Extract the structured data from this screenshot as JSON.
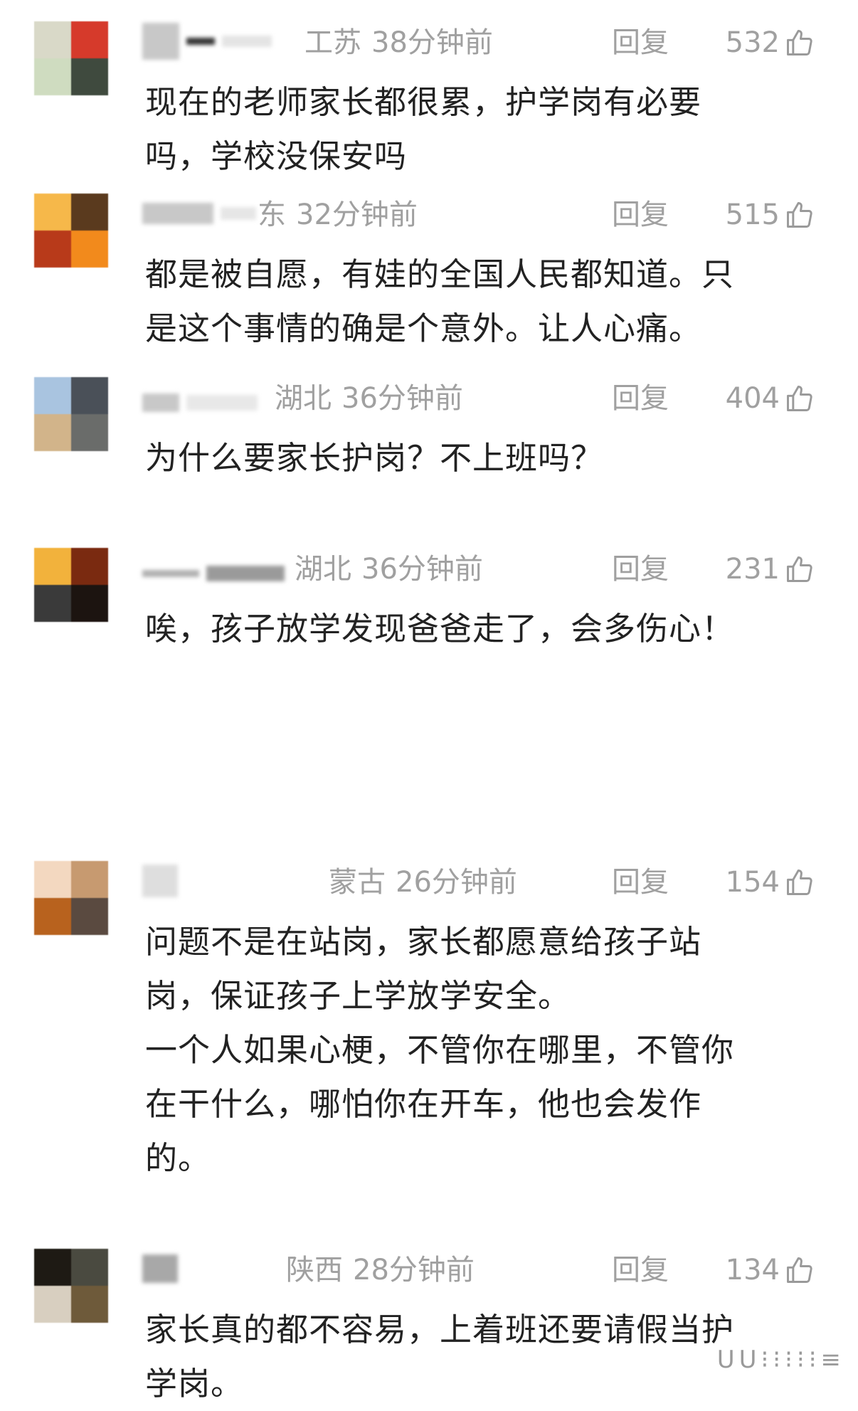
{
  "reply_label": "回复",
  "comments": [
    {
      "location": "工苏",
      "time": "38分钟前",
      "likes": "532",
      "text": "现在的老师家长都很累，护学岗有必要\n吗，学校没保安吗",
      "avatar_colors": [
        "#d9d9c8",
        "#d63a2b",
        "#cfdcc0",
        "#3f4a3e"
      ]
    },
    {
      "location": "东",
      "time": "32分钟前",
      "likes": "515",
      "text": "都是被自愿，有娃的全国人民都知道。只\n是这个事情的确是个意外。让人心痛。",
      "avatar_colors": [
        "#f6b84a",
        "#5a3a1e",
        "#b83a1a",
        "#f28a1c"
      ]
    },
    {
      "location": "湖北",
      "time": "36分钟前",
      "likes": "404",
      "text": "为什么要家长护岗？不上班吗？",
      "avatar_colors": [
        "#a9c4e0",
        "#4a5058",
        "#d2b48a",
        "#6a6c6a"
      ]
    },
    {
      "location": "湖北",
      "time": "36分钟前",
      "likes": "231",
      "text": "唉，孩子放学发现爸爸走了，会多伤心！",
      "avatar_colors": [
        "#f2b23c",
        "#7a2a10",
        "#3a3a3a",
        "#1c1410"
      ]
    },
    {
      "location": "蒙古",
      "time": "26分钟前",
      "likes": "154",
      "text": "问题不是在站岗，家长都愿意给孩子站\n岗，保证孩子上学放学安全。\n一个人如果心梗，不管你在哪里，不管你\n在干什么，哪怕你在开车，他也会发作\n的。",
      "avatar_colors": [
        "#f3d8c0",
        "#c79a70",
        "#b8621e",
        "#5a4a40"
      ]
    },
    {
      "location": "陕西",
      "time": "28分钟前",
      "likes": "134",
      "text": "家长真的都不容易，上着班还要请假当护\n学岗。",
      "avatar_colors": [
        "#1e1a14",
        "#4a4a40",
        "#d8cfc0",
        "#6e5a3a"
      ]
    }
  ]
}
